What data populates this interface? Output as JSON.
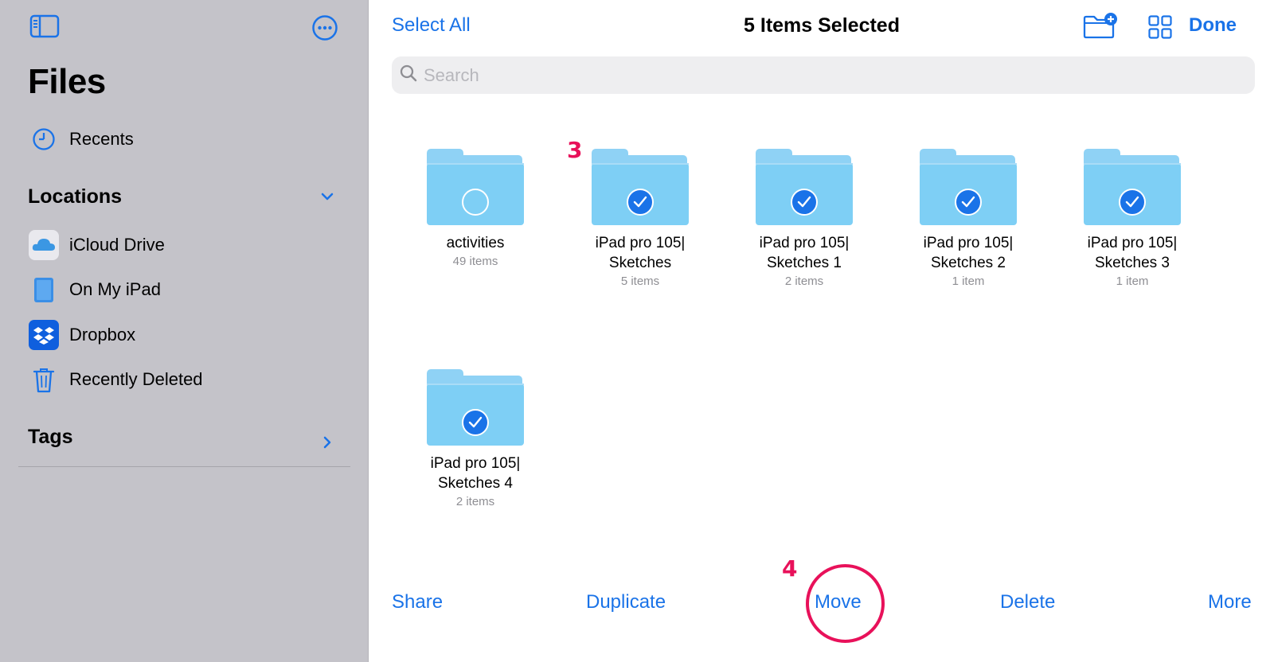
{
  "sidebar": {
    "title": "Files",
    "recents_label": "Recents",
    "locations_heading": "Locations",
    "locations": [
      {
        "label": "iCloud Drive",
        "icon": "icloud-icon"
      },
      {
        "label": "On My iPad",
        "icon": "ipad-icon"
      },
      {
        "label": "Dropbox",
        "icon": "dropbox-icon"
      },
      {
        "label": "Recently Deleted",
        "icon": "trash-icon"
      }
    ],
    "tags_heading": "Tags"
  },
  "toolbar": {
    "select_all_label": "Select All",
    "title": "5 Items Selected",
    "done_label": "Done"
  },
  "search": {
    "placeholder": "Search"
  },
  "items": [
    {
      "name_line1": "activities",
      "name_line2": "",
      "count": "49 items",
      "selected": false
    },
    {
      "name_line1": "iPad pro 105|",
      "name_line2": "Sketches",
      "count": "5 items",
      "selected": true
    },
    {
      "name_line1": "iPad pro 105|",
      "name_line2": "Sketches 1",
      "count": "2 items",
      "selected": true
    },
    {
      "name_line1": "iPad pro 105|",
      "name_line2": "Sketches 2",
      "count": "1 item",
      "selected": true
    },
    {
      "name_line1": "iPad pro 105|",
      "name_line2": "Sketches 3",
      "count": "1 item",
      "selected": true
    },
    {
      "name_line1": "iPad pro 105|",
      "name_line2": "Sketches 4",
      "count": "2 items",
      "selected": true
    }
  ],
  "bottom_bar": {
    "share_label": "Share",
    "duplicate_label": "Duplicate",
    "move_label": "Move",
    "delete_label": "Delete",
    "more_label": "More"
  },
  "annotations": {
    "step3": "3",
    "step4": "4"
  },
  "colors": {
    "accent": "#1a73e8",
    "annotation": "#e8115a",
    "sidebar_bg": "#c4c3c9",
    "folder": "#7ecff5"
  }
}
